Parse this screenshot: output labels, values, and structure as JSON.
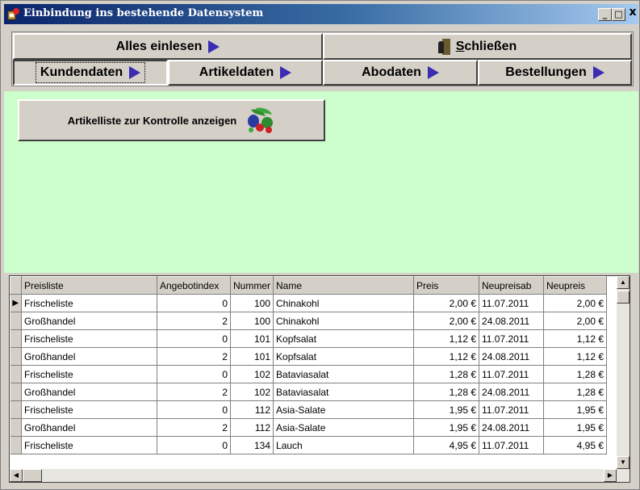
{
  "window": {
    "title": "Einbindung  ins bestehende Datensystem",
    "controls": {
      "minimize": "_",
      "maximize": "□",
      "close": "x"
    }
  },
  "nav": {
    "alles_einlesen": "Alles einlesen",
    "schliessen_underlined": "S",
    "schliessen_rest": "chließen",
    "kundendaten": "Kundendaten",
    "artikeldaten": "Artikeldaten",
    "abodaten": "Abodaten",
    "bestellungen": "Bestellungen"
  },
  "content": {
    "artikelliste_button": "Artikelliste zur Kontrolle anzeigen",
    "background_color": "#ccffcc"
  },
  "grid": {
    "columns": [
      "Preisliste",
      "Angebotindex",
      "Nummer",
      "Name",
      "Preis",
      "Neupreisab",
      "Neupreis"
    ],
    "current_row_indicator": "▶",
    "rows": [
      [
        "Frischeliste",
        "0",
        "100",
        "Chinakohl",
        "2,00 €",
        "11.07.2011",
        "2,00 €"
      ],
      [
        "Großhandel",
        "2",
        "100",
        "Chinakohl",
        "2,00 €",
        "24.08.2011",
        "2,00 €"
      ],
      [
        "Frischeliste",
        "0",
        "101",
        "Kopfsalat",
        "1,12 €",
        "11.07.2011",
        "1,12 €"
      ],
      [
        "Großhandel",
        "2",
        "101",
        "Kopfsalat",
        "1,12 €",
        "24.08.2011",
        "1,12 €"
      ],
      [
        "Frischeliste",
        "0",
        "102",
        "Bataviasalat",
        "1,28 €",
        "11.07.2011",
        "1,28 €"
      ],
      [
        "Großhandel",
        "2",
        "102",
        "Bataviasalat",
        "1,28 €",
        "24.08.2011",
        "1,28 €"
      ],
      [
        "Frischeliste",
        "0",
        "112",
        "Asia-Salate",
        "1,95 €",
        "11.07.2011",
        "1,95 €"
      ],
      [
        "Großhandel",
        "2",
        "112",
        "Asia-Salate",
        "1,95 €",
        "24.08.2011",
        "1,95 €"
      ],
      [
        "Frischeliste",
        "0",
        "134",
        "Lauch",
        "4,95 €",
        "11.07.2011",
        "4,95 €"
      ]
    ]
  },
  "colors": {
    "arrow": "#3c2bb3",
    "titlebar": "#0a246a"
  },
  "icons": [
    "app-icon",
    "arrow-right-icon",
    "door-exit-icon",
    "vegetables-icon",
    "scroll-up-icon",
    "scroll-down-icon",
    "scroll-left-icon",
    "scroll-right-icon"
  ]
}
